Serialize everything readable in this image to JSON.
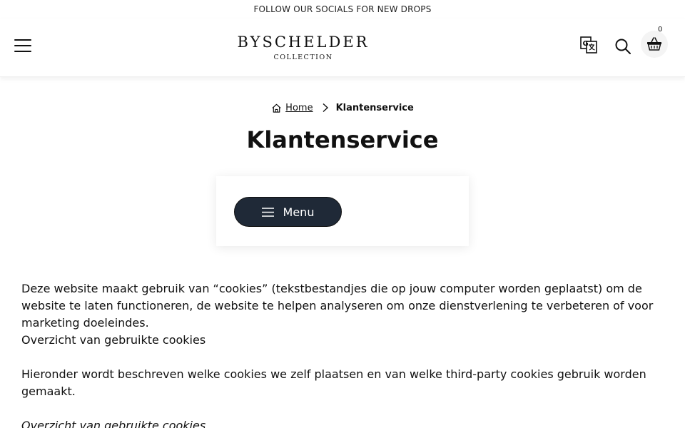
{
  "announcement": "FOLLOW OUR SOCIALS FOR NEW DROPS",
  "logo": {
    "main": "BYSCHELDER",
    "sub": "COLLECTION"
  },
  "cart": {
    "count": "0"
  },
  "breadcrumb": {
    "home": "Home",
    "current": "Klantenservice"
  },
  "page": {
    "title": "Klantenservice"
  },
  "menu": {
    "label": "Menu"
  },
  "content": {
    "p1": "Deze website maakt gebruik van “cookies” (tekstbestandjes die op jouw computer worden geplaatst) om de website te laten functioneren, de website te helpen analyseren om onze dienstverlening te verbeteren of voor marketing doeleindes.",
    "p2": "Overzicht van gebruikte cookies",
    "p3": "Hieronder wordt beschreven welke cookies we zelf plaatsen en van welke third-party cookies gebruik worden gemaakt.",
    "p4": "Overzicht van gebruikte cookies"
  },
  "colors": {
    "button_bg": "#1f2937",
    "text": "#111111",
    "background": "#ffffff"
  },
  "icons": {
    "menu": "hamburger-icon",
    "translate": "translate-icon",
    "search": "search-icon",
    "cart": "basket-icon",
    "home": "home-icon",
    "separator": "chevron-right-icon"
  }
}
